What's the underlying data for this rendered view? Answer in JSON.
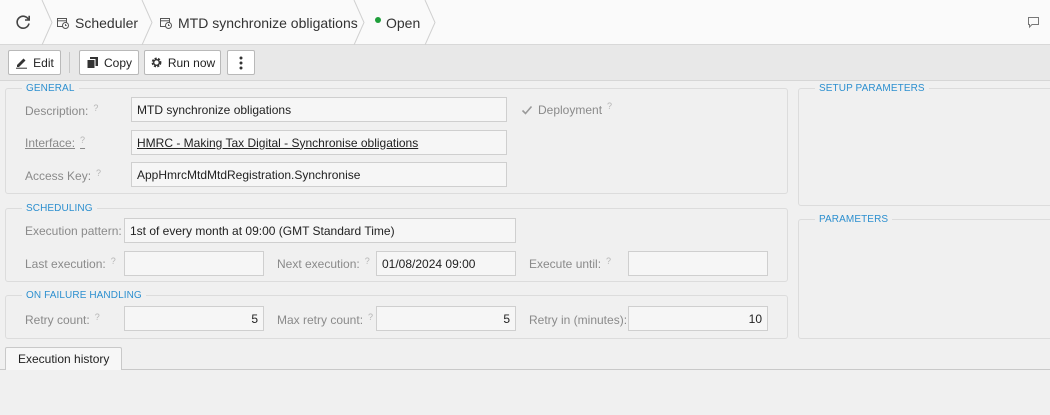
{
  "breadcrumb": {
    "items": [
      {
        "label": "Scheduler"
      },
      {
        "label": "MTD synchronize obligations"
      },
      {
        "label": "Open"
      }
    ],
    "status_color": "#1e9e3a"
  },
  "toolbar": {
    "edit_label": "Edit",
    "copy_label": "Copy",
    "run_now_label": "Run now"
  },
  "general": {
    "legend": "GENERAL",
    "description_label": "Description:",
    "description_value": "MTD synchronize obligations",
    "interface_label": "Interface:",
    "interface_value": "HMRC - Making Tax Digital - Synchronise obligations",
    "access_key_label": "Access Key:",
    "access_key_value": "AppHmrcMtdMtdRegistration.Synchronise",
    "deployment_label": "Deployment",
    "deployment_checked": true
  },
  "scheduling": {
    "legend": "SCHEDULING",
    "execution_pattern_label": "Execution pattern:",
    "execution_pattern_value": "1st of every month at 09:00 (GMT Standard Time)",
    "last_execution_label": "Last execution:",
    "last_execution_value": "",
    "next_execution_label": "Next execution:",
    "next_execution_value": "01/08/2024 09:00",
    "execute_until_label": "Execute until:",
    "execute_until_value": ""
  },
  "failure": {
    "legend": "ON FAILURE HANDLING",
    "retry_count_label": "Retry count:",
    "retry_count_value": "5",
    "max_retry_label": "Max retry count:",
    "max_retry_value": "5",
    "retry_in_label": "Retry in (minutes):",
    "retry_in_value": "10"
  },
  "setup_parameters": {
    "legend": "SETUP PARAMETERS"
  },
  "parameters": {
    "legend": "PARAMETERS"
  },
  "tabs": [
    {
      "label": "Execution history"
    }
  ],
  "help_mark": "?",
  "colors": {
    "accent": "#2c8fcf",
    "status_open": "#1e9e3a"
  }
}
